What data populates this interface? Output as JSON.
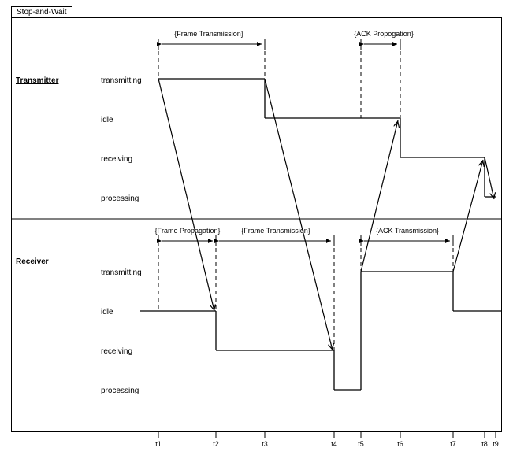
{
  "tab_title": "Stop-and-Wait",
  "roles": {
    "transmitter": "Transmitter",
    "receiver": "Receiver"
  },
  "states": {
    "transmitting": "transmitting",
    "idle": "idle",
    "receiving": "receiving",
    "processing": "processing"
  },
  "annotations": {
    "frame_transmission_top": "{Frame Transmission}",
    "ack_propagation_top": "{ACK Propogation}",
    "frame_propagation_bottom": "{Frame Propagation}",
    "frame_transmission_bottom": "{Frame Transmission}",
    "ack_transmission_bottom": "{ACK Transmission}"
  },
  "ticks": {
    "t1": "t1",
    "t2": "t2",
    "t3": "t3",
    "t4": "t4",
    "t5": "t5",
    "t6": "t6",
    "t7": "t7",
    "t8": "t8",
    "t9": "t9"
  },
  "chart_data": {
    "type": "timing-diagram",
    "title": "Stop-and-Wait",
    "time_points": [
      "t1",
      "t2",
      "t3",
      "t4",
      "t5",
      "t6",
      "t7",
      "t8",
      "t9"
    ],
    "lanes": [
      {
        "name": "Transmitter",
        "states_order": [
          "transmitting",
          "idle",
          "receiving",
          "processing"
        ],
        "segments": [
          {
            "from": "t1",
            "to": "t3",
            "state": "transmitting"
          },
          {
            "from": "t3",
            "to": "t6",
            "state": "idle"
          },
          {
            "from": "t6",
            "to": "t8",
            "state": "receiving"
          },
          {
            "from": "t8",
            "to": "t9",
            "state": "processing"
          }
        ]
      },
      {
        "name": "Receiver",
        "states_order": [
          "transmitting",
          "idle",
          "receiving",
          "processing"
        ],
        "segments": [
          {
            "from": "start",
            "to": "t2",
            "state": "idle"
          },
          {
            "from": "t2",
            "to": "t4",
            "state": "receiving"
          },
          {
            "from": "t4",
            "to": "t5",
            "state": "processing"
          },
          {
            "from": "t5",
            "to": "t7",
            "state": "transmitting"
          },
          {
            "from": "t7",
            "to": "end",
            "state": "idle"
          }
        ]
      }
    ],
    "slanted_transitions": [
      {
        "from_lane": "Transmitter",
        "from_state": "transmitting",
        "from_t": "t1",
        "to_lane": "Receiver",
        "to_state": "idle",
        "to_t": "t2",
        "label": "{Frame Propagation}"
      },
      {
        "from_lane": "Transmitter",
        "from_state": "transmitting",
        "from_t": "t3",
        "to_lane": "Receiver",
        "to_state": "receiving",
        "to_t": "t4",
        "label": "{Frame Transmission}"
      },
      {
        "from_lane": "Receiver",
        "from_state": "transmitting",
        "from_t": "t5",
        "to_lane": "Transmitter",
        "to_state": "idle",
        "to_t": "t6",
        "label": "{ACK Propogation}"
      },
      {
        "from_lane": "Receiver",
        "from_state": "transmitting",
        "from_t": "t7",
        "to_lane": "Transmitter",
        "to_state": "receiving",
        "to_t": "t8",
        "label": "{ACK Transmission}"
      }
    ],
    "top_spans": [
      {
        "from": "t1",
        "to": "t3",
        "label": "{Frame Transmission}"
      },
      {
        "from": "t5",
        "to": "t6",
        "label": "{ACK Propogation}"
      }
    ],
    "bottom_spans": [
      {
        "from": "t1",
        "to": "t2",
        "label": "{Frame Propagation}"
      },
      {
        "from": "t2",
        "to": "t4",
        "label": "{Frame Transmission}"
      },
      {
        "from": "t5",
        "to": "t7",
        "label": "{ACK Transmission}"
      }
    ]
  }
}
